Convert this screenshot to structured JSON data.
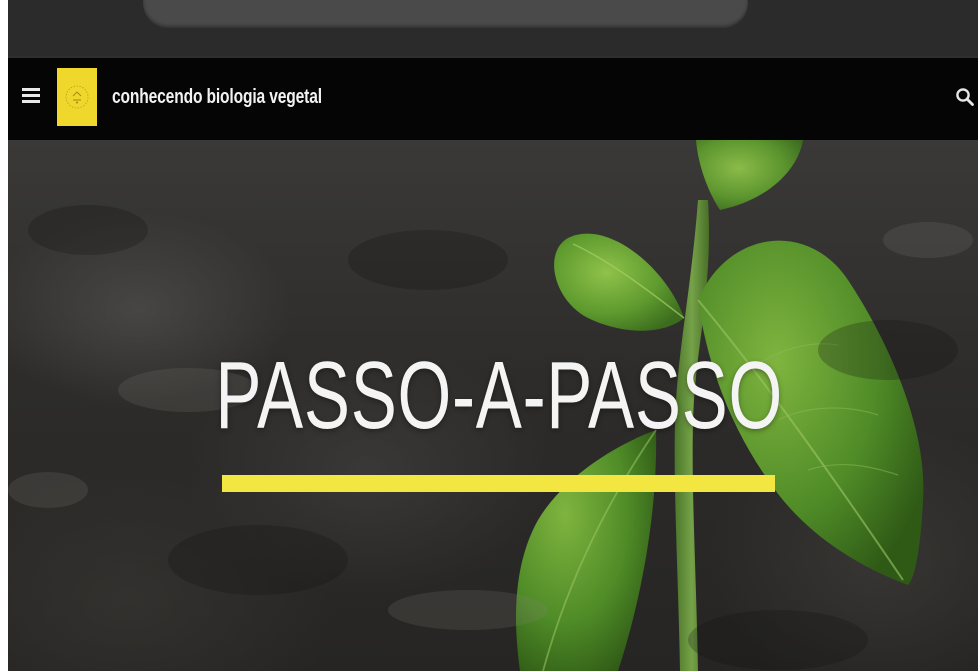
{
  "header": {
    "site_title": "conhecendo biologia vegetal",
    "menu_icon": "hamburger-menu-icon",
    "search_icon": "search-icon",
    "logo_color": "#f0d72b"
  },
  "hero": {
    "title": "PASSO-A-PASSO",
    "underline_color": "#f3e641"
  }
}
